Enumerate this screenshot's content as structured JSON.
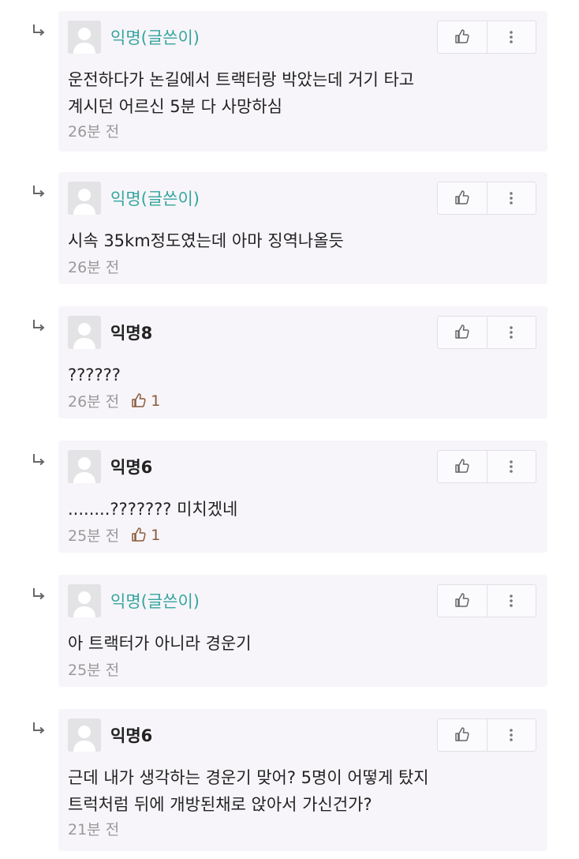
{
  "comments": [
    {
      "author": "익명(글쓴이)",
      "is_op": true,
      "body": [
        "운전하다가 논길에서 트랙터랑 박았는데 거기 타고",
        "계시던 어르신 5분 다 사망하심"
      ],
      "time": "26분 전",
      "likes": null
    },
    {
      "author": "익명(글쓴이)",
      "is_op": true,
      "body": [
        "시속 35km정도였는데 아마 징역나올듯"
      ],
      "time": "26분 전",
      "likes": null
    },
    {
      "author": "익명8",
      "is_op": false,
      "body": [
        "??????"
      ],
      "time": "26분 전",
      "likes": "1"
    },
    {
      "author": "익명6",
      "is_op": false,
      "body": [
        "........??????? 미치겠네"
      ],
      "time": "25분 전",
      "likes": "1"
    },
    {
      "author": "익명(글쓴이)",
      "is_op": true,
      "body": [
        "아 트랙터가 아니라 경운기"
      ],
      "time": "25분 전",
      "likes": null
    },
    {
      "author": "익명6",
      "is_op": false,
      "body": [
        "근데 내가 생각하는 경운기 맞어? 5명이 어떻게 탔지",
        "트럭처럼 뒤에 개방된채로 앉아서 가신건가?"
      ],
      "time": "21분 전",
      "likes": null
    }
  ],
  "icons": {
    "reply_arrow": "reply-arrow-icon",
    "avatar": "default-avatar-icon",
    "like": "thumbs-up-icon",
    "more": "more-vertical-icon"
  },
  "colors": {
    "op_name": "#35a5a0",
    "card_bg": "#f7f5f9",
    "like_count": "#8a5a3a",
    "meta_text": "#999999"
  }
}
